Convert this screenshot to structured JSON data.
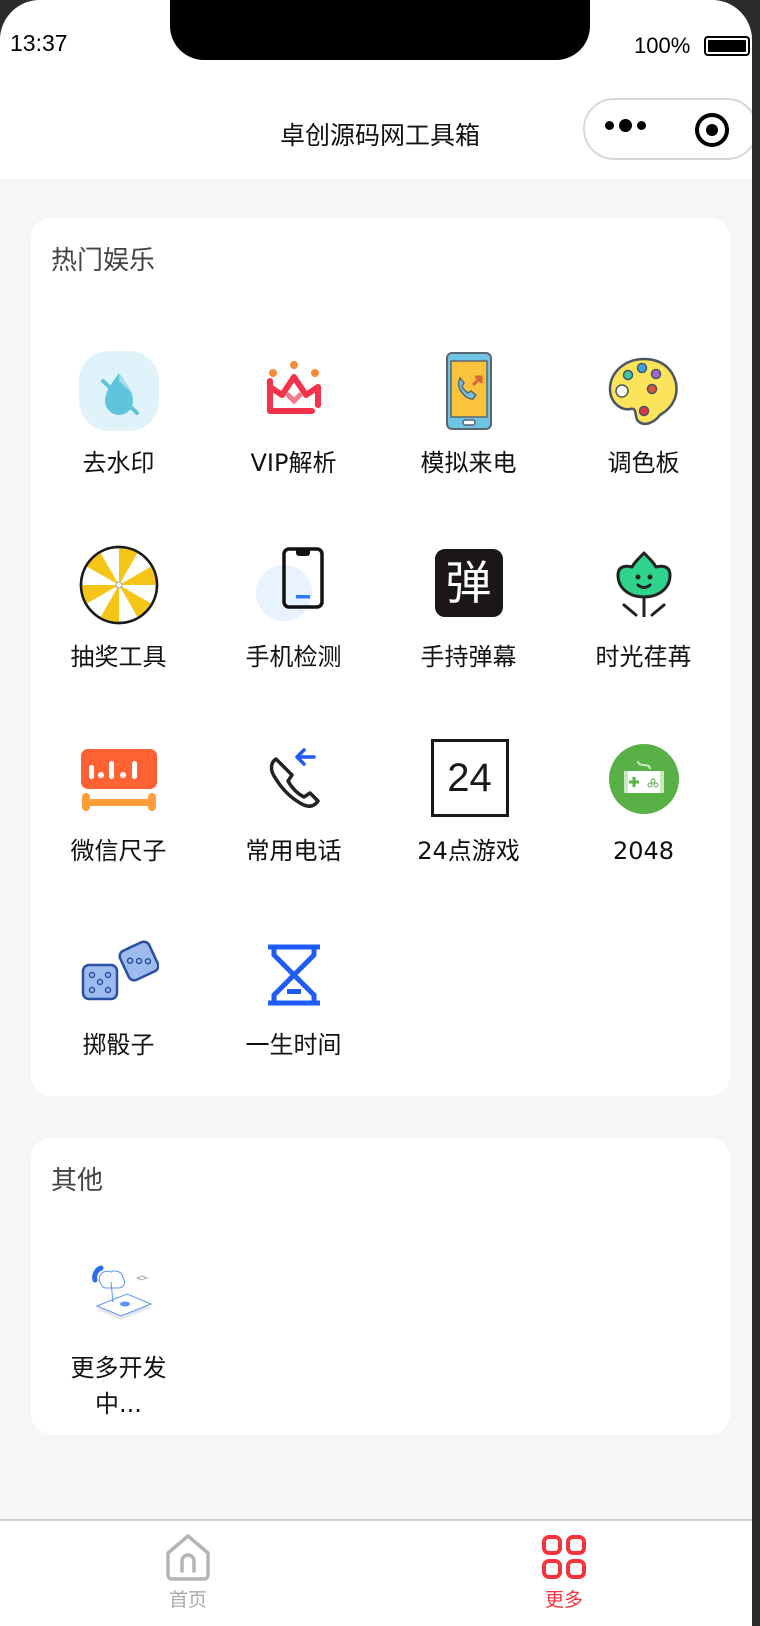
{
  "status_bar": {
    "time": "13:37",
    "battery_percent": "100%",
    "battery_level": 1.0
  },
  "nav": {
    "title": "卓创源码网工具箱",
    "menu_icon": "more-dots-icon",
    "close_icon": "target-circle-icon"
  },
  "sections": [
    {
      "title": "热门娱乐",
      "items": [
        {
          "label": "去水印",
          "icon": "water-drop-slash-icon"
        },
        {
          "label": "VIP解析",
          "icon": "crown-heart-icon"
        },
        {
          "label": "模拟来电",
          "icon": "phone-call-icon"
        },
        {
          "label": "调色板",
          "icon": "palette-icon"
        },
        {
          "label": "抽奖工具",
          "icon": "lottery-wheel-icon"
        },
        {
          "label": "手机检测",
          "icon": "smartphone-icon"
        },
        {
          "label": "手持弹幕",
          "icon": "danmaku-icon",
          "glyph": "弹"
        },
        {
          "label": "时光荏苒",
          "icon": "smiling-flower-icon"
        },
        {
          "label": "微信尺子",
          "icon": "ruler-icon"
        },
        {
          "label": "常用电话",
          "icon": "incoming-call-icon"
        },
        {
          "label": "24点游戏",
          "icon": "24-card-icon",
          "glyph": "24"
        },
        {
          "label": "2048",
          "icon": "gamepad-icon"
        },
        {
          "label": "掷骰子",
          "icon": "dice-icon"
        },
        {
          "label": "一生时间",
          "icon": "hourglass-icon"
        }
      ]
    },
    {
      "title": "其他",
      "items": [
        {
          "label": "更多开发中...",
          "icon": "cloud-device-illustration-icon"
        }
      ]
    }
  ],
  "tabbar": [
    {
      "label": "首页",
      "icon": "home-icon",
      "active": false,
      "color": "#aaaaaa"
    },
    {
      "label": "更多",
      "icon": "grid-icon",
      "active": true,
      "color": "#f5333f"
    }
  ],
  "colors": {
    "accent": "#f5333f",
    "background": "#f7f6f7",
    "card": "#ffffff"
  }
}
